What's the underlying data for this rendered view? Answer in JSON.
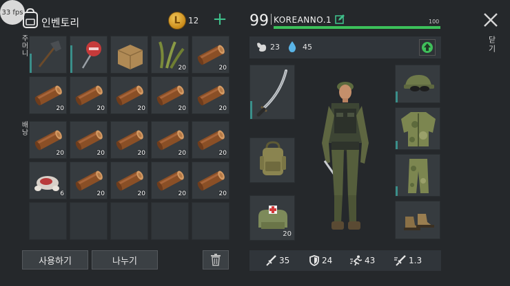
{
  "fps_badge": "33 fps",
  "inventory": {
    "title": "인벤토리",
    "coins": "12",
    "plus": "+",
    "pocket_label": "주머니",
    "backpack_label": "배낭",
    "slots": [
      {
        "item": "shovel-icon",
        "count": ""
      },
      {
        "item": "stop-sign-icon",
        "count": ""
      },
      {
        "item": "cardboard-box-icon",
        "count": ""
      },
      {
        "item": "plant-fiber-icon",
        "count": "20"
      },
      {
        "item": "log-icon",
        "count": "20"
      },
      {
        "item": "log-icon",
        "count": "20"
      },
      {
        "item": "log-icon",
        "count": "20"
      },
      {
        "item": "log-icon",
        "count": "20"
      },
      {
        "item": "log-icon",
        "count": "20"
      },
      {
        "item": "log-icon",
        "count": "20"
      },
      {
        "item": "log-icon",
        "count": "20"
      },
      {
        "item": "log-icon",
        "count": "20"
      },
      {
        "item": "log-icon",
        "count": "20"
      },
      {
        "item": "log-icon",
        "count": "20"
      },
      {
        "item": "log-icon",
        "count": "20"
      },
      {
        "item": "raw-meat-icon",
        "count": "6"
      },
      {
        "item": "log-icon",
        "count": "20"
      },
      {
        "item": "log-icon",
        "count": "20"
      },
      {
        "item": "log-icon",
        "count": "20"
      },
      {
        "item": "log-icon",
        "count": "20"
      }
    ],
    "use_button": "사용하기",
    "split_button": "나누기"
  },
  "character": {
    "level": "99",
    "name": "KOREANNO.1",
    "hp_max": "100",
    "hp_fraction": 1.0,
    "food": "23",
    "water": "45",
    "weapon_slot": "katana-icon",
    "backpack_slot": "backpack-icon",
    "medkit_slot": "medkit-bag-icon",
    "medkit_count": "20",
    "head_slot": "military-cap-icon",
    "torso_slot": "camo-jacket-icon",
    "legs_slot": "camo-pants-icon",
    "feet_slot": "boots-icon",
    "attack": "35",
    "defense": "24",
    "speed": "43",
    "attack_speed": "1.3"
  },
  "close_label": "닫기",
  "colors": {
    "accent_green": "#3fbf8a",
    "hp_green": "#3cc15a",
    "bg": "#25282b",
    "slot_bg": "#363b3f"
  }
}
